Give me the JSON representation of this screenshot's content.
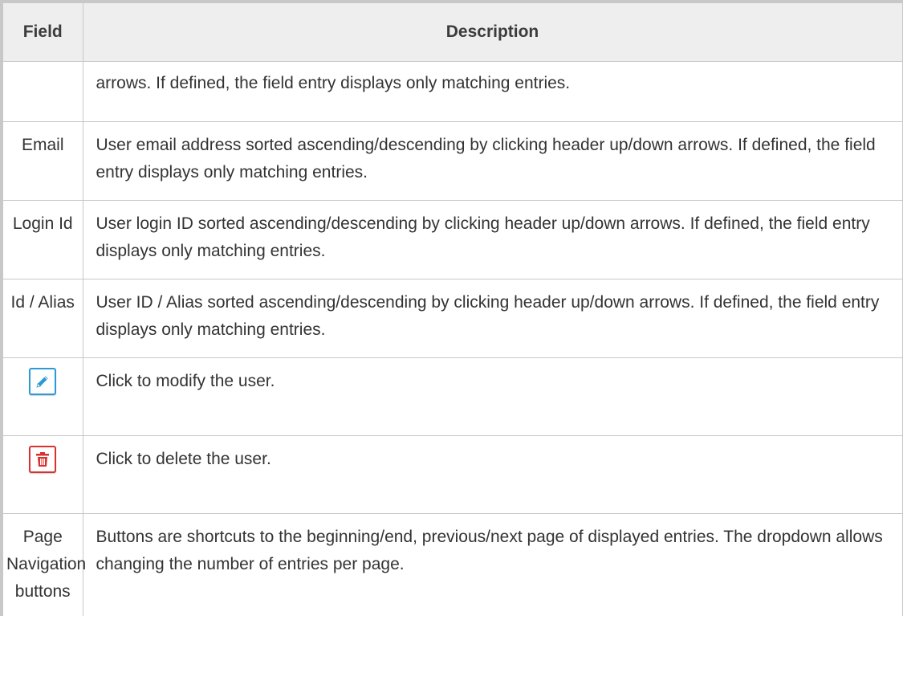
{
  "table": {
    "headers": {
      "field": "Field",
      "description": "Description"
    },
    "rows": [
      {
        "field": "",
        "description": "arrows. If defined, the field entry displays only matching entries."
      },
      {
        "field": "Email",
        "description": "User email address sorted ascending/descending by clicking header up/down arrows. If defined, the field entry displays only matching entries."
      },
      {
        "field": "Login Id",
        "description": "User login ID sorted ascending/descending by clicking header up/down arrows. If defined, the field entry displays only matching entries."
      },
      {
        "field": "Id / Alias",
        "description": "User ID / Alias sorted ascending/descending by clicking header up/down arrows. If defined, the field entry displays only matching entries."
      },
      {
        "field_icon": "pencil-edit-icon",
        "description": "Click to modify the user."
      },
      {
        "field_icon": "trash-delete-icon",
        "description": "Click to delete the user."
      },
      {
        "field": "Page Navigation buttons",
        "description": "Buttons are shortcuts to the beginning/end, previous/next page of displayed entries.  The dropdown allows changing the number of entries per page."
      }
    ]
  },
  "colors": {
    "edit_icon": "#2a9bd6",
    "delete_icon": "#d9312e",
    "header_bg": "#eeeeee",
    "border": "#c8c8c8"
  }
}
